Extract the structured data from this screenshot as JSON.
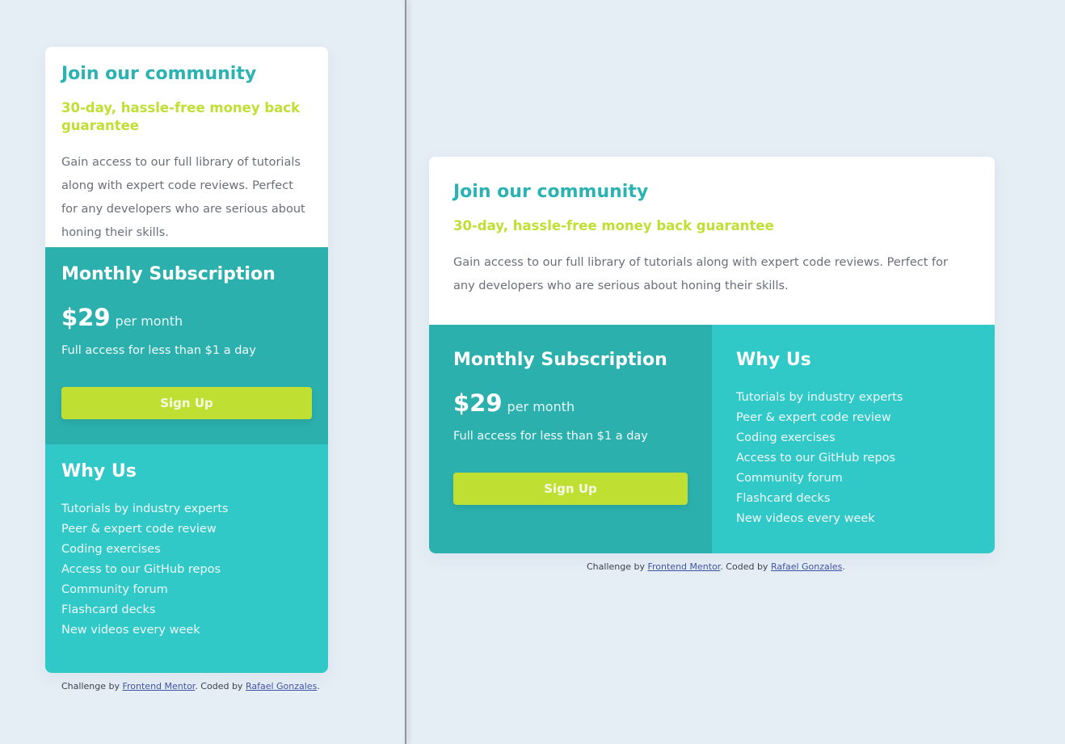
{
  "card": {
    "title": "Join our community",
    "subtitle": "30-day, hassle-free money back guarantee",
    "description": "Gain access to our full library of tutorials along with expert code reviews. Perfect for any developers who are serious about honing their skills."
  },
  "subscription": {
    "heading": "Monthly Subscription",
    "price": "$29",
    "period": "per month",
    "note": "Full access for less than $1 a day",
    "button_label": "Sign Up"
  },
  "why_us": {
    "heading": "Why Us",
    "items": [
      "Tutorials by industry experts",
      "Peer & expert code review",
      "Coding exercises",
      "Access to our GitHub repos",
      "Community forum",
      "Flashcard decks",
      "New videos every week"
    ]
  },
  "attribution": {
    "prefix": "Challenge by",
    "challenge_link": "Frontend Mentor",
    "middle": ". Coded by",
    "author_link": "Rafael Gonzales",
    "suffix": "."
  },
  "colors": {
    "background": "#e5edf5",
    "title": "#2bb3b1",
    "subtitle": "#bfdf32",
    "subscription_bg": "#2bb0ae",
    "why_bg": "#31c9c7",
    "button_bg": "#bfe032"
  }
}
